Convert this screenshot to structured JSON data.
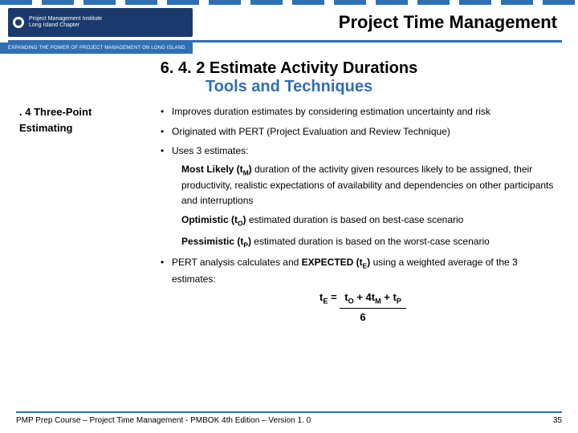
{
  "logo": {
    "line1": "Project Management Institute",
    "line2": "Long Island Chapter",
    "tagline": "EXPANDING THE POWER OF PROJECT MANAGEMENT ON LONG ISLAND"
  },
  "title": "Project Time Management",
  "subtitle": "6. 4. 2 Estimate Activity Durations",
  "subtitle2": "Tools and Techniques",
  "section": {
    "num": ". 4",
    "label": "Three-Point Estimating"
  },
  "bullets": {
    "b1": "Improves duration estimates by considering estimation uncertainty and risk",
    "b2": "Originated with PERT (Project Evaluation and Review Technique)",
    "b3": "Uses 3 estimates:",
    "b4_pre": "PERT analysis calculates and ",
    "b4_bold": "EXPECTED (t",
    "b4_sub": "E",
    "b4_bold2": ")",
    "b4_post": " using a weighted average of the 3 estimates:"
  },
  "estimates": {
    "ml_b": "Most Likely  (t",
    "ml_sub": "M",
    "ml_b2": ")",
    "ml_rest": " duration of the activity given resources likely to be assigned, their productivity, realistic expectations of availability and dependencies on other participants and interruptions",
    "op_b": "Optimistic (t",
    "op_sub": "O",
    "op_b2": ")",
    "op_rest": " estimated duration is based on best-case scenario",
    "pe_b": "Pessimistic (t",
    "pe_sub": "P",
    "pe_b2": ")",
    "pe_rest": " estimated duration is based on the worst-case scenario"
  },
  "formula": {
    "lhs": "t",
    "lhs_sub": "E",
    "eq": "  =  ",
    "t1": "t",
    "s1": "O",
    "plus1": "  +  4",
    "t2": "t",
    "s2": "M",
    "plus2": "  +  ",
    "t3": "t",
    "s3": "P",
    "den": "6"
  },
  "footer": {
    "text": "PMP Prep Course – Project Time Management - PMBOK 4th Edition – Version 1. 0",
    "page": "35"
  }
}
